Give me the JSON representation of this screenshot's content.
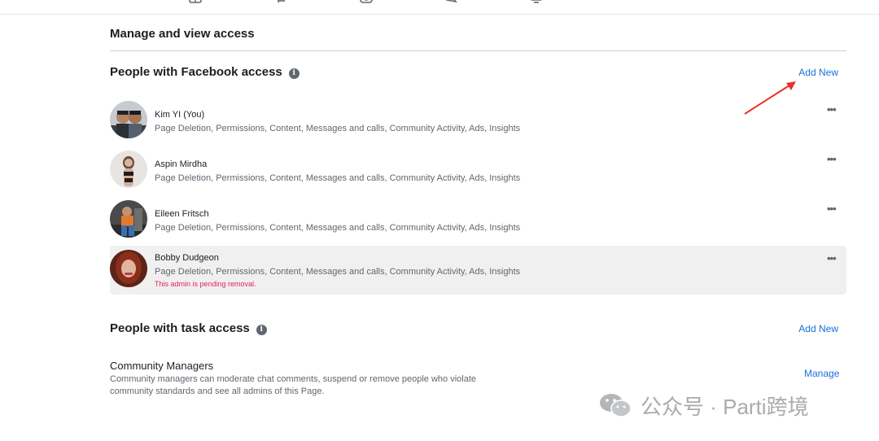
{
  "page": {
    "section_title": "Manage and view access"
  },
  "facebook_access": {
    "title": "People with Facebook access",
    "add_new_label": "Add New",
    "people": [
      {
        "name": "Kim YI (You)",
        "permissions": "Page Deletion, Permissions, Content, Messages and calls, Community Activity, Ads, Insights",
        "note": "",
        "more_label": "•••"
      },
      {
        "name": "Aspin Mirdha",
        "permissions": "Page Deletion, Permissions, Content, Messages and calls, Community Activity, Ads, Insights",
        "note": "",
        "more_label": "•••"
      },
      {
        "name": "Eileen Fritsch",
        "permissions": "Page Deletion, Permissions, Content, Messages and calls, Community Activity, Ads, Insights",
        "note": "",
        "more_label": "•••"
      },
      {
        "name": "Bobby Dudgeon",
        "permissions": "Page Deletion, Permissions, Content, Messages and calls, Community Activity, Ads, Insights",
        "note": "This admin is pending removal.",
        "more_label": "•••"
      }
    ]
  },
  "task_access": {
    "title": "People with task access",
    "add_new_label": "Add New",
    "community_managers": {
      "title": "Community Managers",
      "description": "Community managers can moderate chat comments, suspend or remove people who violate community standards and see all admins of this Page.",
      "manage_label": "Manage"
    }
  },
  "watermark": {
    "text": "公众号 · Parti跨境"
  },
  "colors": {
    "link": "#1b6fd8",
    "pending_highlight": "#f0f0f0",
    "warning": "#e0245e",
    "annotation_arrow": "#e8322a"
  }
}
